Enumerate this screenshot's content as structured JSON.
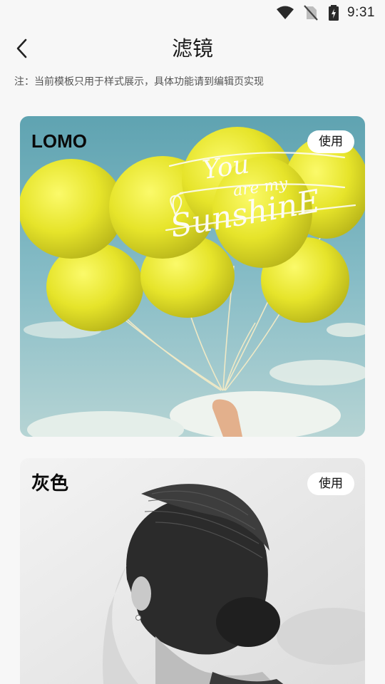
{
  "status_bar": {
    "time": "9:31",
    "icons": [
      "wifi-icon",
      "no-sim-icon",
      "battery-charging-icon"
    ]
  },
  "header": {
    "back_icon": "chevron-left-icon",
    "title": "滤镜"
  },
  "notice": "注：当前模板只用于样式展示，具体功能请到编辑页实现",
  "filters": [
    {
      "name": "LOMO",
      "button_label": "使用",
      "image": "yellow-balloons-photo",
      "handwriting": [
        "You",
        "are my",
        "SunshinE"
      ]
    },
    {
      "name": "灰色",
      "button_label": "使用",
      "image": "grayscale-portrait-photo"
    }
  ],
  "colors": {
    "background": "#f7f7f7",
    "button_bg": "#ffffff",
    "balloon_yellow": "#e8e62a",
    "sky_blue": "#7fb6c2"
  }
}
